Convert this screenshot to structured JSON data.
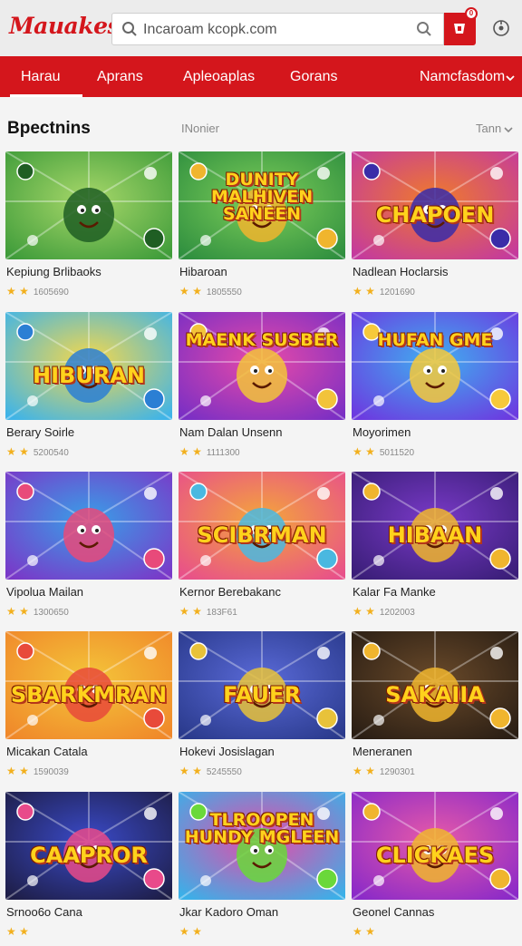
{
  "header": {
    "logo": "Mauakest",
    "search_value": "Incaroam kcopk.com",
    "cart_badge": "0"
  },
  "nav": {
    "items": [
      {
        "label": "Harau",
        "active": true
      },
      {
        "label": "Aprans",
        "active": false
      },
      {
        "label": "Apleoaplas",
        "active": false
      },
      {
        "label": "Gorans",
        "active": false
      },
      {
        "label": "Namcfasdom",
        "active": false
      }
    ]
  },
  "section": {
    "title": "Bpectnins",
    "subtitle": "INonier",
    "sort_label": "Tann"
  },
  "games": [
    {
      "title": "Kepiung Brlibaoks",
      "stars": "★ ★",
      "count": "1605690",
      "banner": "",
      "theme": "jungle"
    },
    {
      "title": "Hibaroan",
      "stars": "★ ★",
      "count": "1805550",
      "banner": "DUNITY MALHIVEN SANEEN",
      "theme": "jungle2"
    },
    {
      "title": "Nadlean Hoclarsis",
      "stars": "★ ★",
      "count": "1201690",
      "banner": "CHAPOEN",
      "theme": "disco"
    },
    {
      "title": "Berary Soirle",
      "stars": "★ ★",
      "count": "5200540",
      "banner": "HIBURAN",
      "theme": "sky"
    },
    {
      "title": "Nam Dalan Unsenn",
      "stars": "★ ★",
      "count": "1111300",
      "banner": "MAENK SUSBER",
      "theme": "candy"
    },
    {
      "title": "Moyorimen",
      "stars": "★ ★",
      "count": "5011520",
      "banner": "HUFAN GME",
      "theme": "purple"
    },
    {
      "title": "Vipolua Mailan",
      "stars": "★ ★",
      "count": "1300650",
      "banner": "",
      "theme": "bubble"
    },
    {
      "title": "Kernor Berebakanc",
      "stars": "★ ★",
      "count": "183F61",
      "banner": "SCIBRMAN",
      "theme": "party"
    },
    {
      "title": "Kalar Fa Manke",
      "stars": "★ ★",
      "count": "1202003",
      "banner": "HIBAAN",
      "theme": "coins"
    },
    {
      "title": "Micakan Catala",
      "stars": "★ ★",
      "count": "1590039",
      "banner": "SBARKMRAN",
      "theme": "orange"
    },
    {
      "title": "Hokevi Josislagan",
      "stars": "★ ★",
      "count": "5245550",
      "banner": "FAUER",
      "theme": "controller"
    },
    {
      "title": "Meneranen",
      "stars": "★ ★",
      "count": "1290301",
      "banner": "SAKAIIA",
      "theme": "dark"
    },
    {
      "title": "Srnoo6o Cana",
      "stars": "★ ★",
      "count": "",
      "banner": "CAAPROR",
      "theme": "hero"
    },
    {
      "title": "Jkar Kadoro Oman",
      "stars": "★ ★",
      "count": "",
      "banner": "TLROOPEN HUNDY MGLEEN",
      "theme": "party2"
    },
    {
      "title": "Geonel Cannas",
      "stars": "★ ★",
      "count": "",
      "banner": "CLICKAES",
      "theme": "hero2"
    }
  ],
  "colors": {
    "brand": "#d4161c",
    "star": "#f2b01e"
  }
}
